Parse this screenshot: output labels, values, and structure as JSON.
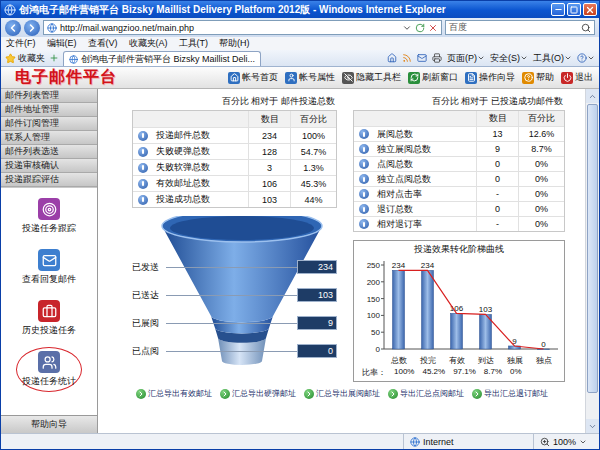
{
  "window": {
    "title": "创鸿电子邮件营销平台 Bizsky Maillist Delivery Platform 2012版 - Windows Internet Explorer"
  },
  "address_bar": {
    "url": "http://mail.wangzioo.net/main.php",
    "search": "百度"
  },
  "menu": [
    "文件(F)",
    "编辑(E)",
    "查看(V)",
    "收藏夹(A)",
    "工具(T)",
    "帮助(H)"
  ],
  "favorites": {
    "label": "收藏夹"
  },
  "tabs": [
    {
      "label": "创鸿电子邮件营销平台 Bizsky Maillist Deli...",
      "selected": true
    }
  ],
  "command_bar": [
    "页面(P)",
    "安全(S)",
    "工具(O)"
  ],
  "app_header": {
    "logo": "电子邮件平台",
    "nav": [
      "帐号首页",
      "帐号属性",
      "隐藏工具栏",
      "刷新窗口",
      "操作向导",
      "帮助",
      "退出"
    ]
  },
  "sidebar": {
    "menu": [
      {
        "label": "邮件列表管理",
        "selected": false
      },
      {
        "label": "邮件地址管理",
        "selected": false
      },
      {
        "label": "邮件订阅管理",
        "selected": false
      },
      {
        "label": "联系人管理",
        "selected": false
      },
      {
        "label": "邮件列表选送",
        "selected": false
      },
      {
        "label": "投递审核确认",
        "selected": false
      },
      {
        "label": "投递跟踪评估",
        "selected": false
      }
    ],
    "tools": [
      {
        "label": "投递任务跟踪",
        "selected": false
      },
      {
        "label": "查看回复邮件",
        "selected": false
      },
      {
        "label": "历史投递任务",
        "selected": false
      },
      {
        "label": "投递任务统计",
        "selected": true
      }
    ],
    "footer": "帮助向导"
  },
  "delivery_table": {
    "caption": "百分比 相对于 邮件投递总数",
    "columns": [
      "数目",
      "百分比"
    ],
    "rows": [
      {
        "label": "投递邮件总数",
        "count": "234",
        "percent": "100%"
      },
      {
        "label": "失败硬弹总数",
        "count": "128",
        "percent": "54.7%"
      },
      {
        "label": "失败软弹总数",
        "count": "3",
        "percent": "1.3%"
      },
      {
        "label": "有效邮址总数",
        "count": "106",
        "percent": "45.3%"
      },
      {
        "label": "投递成功总数",
        "count": "103",
        "percent": "44%"
      }
    ]
  },
  "open_table": {
    "caption": "百分比 相对于 已投递成功邮件数",
    "columns": [
      "数目",
      "百分比"
    ],
    "rows": [
      {
        "label": "展阅总数",
        "count": "13",
        "percent": "12.6%"
      },
      {
        "label": "独立展阅总数",
        "count": "9",
        "percent": "8.7%"
      },
      {
        "label": "点阅总数",
        "count": "0",
        "percent": "0%"
      },
      {
        "label": "独立点阅总数",
        "count": "0",
        "percent": "0%"
      },
      {
        "label": "相对点击率",
        "count": "-",
        "percent": "0%"
      },
      {
        "label": "退订总数",
        "count": "0",
        "percent": "0%"
      },
      {
        "label": "相对退订率",
        "count": "-",
        "percent": "0%"
      }
    ]
  },
  "funnel": {
    "stages": [
      {
        "label": "已发送",
        "value": "234"
      },
      {
        "label": "已送达",
        "value": "103"
      },
      {
        "label": "已展阅",
        "value": "9"
      },
      {
        "label": "已点阅",
        "value": "0"
      }
    ]
  },
  "chart": {
    "title": "投递效果转化阶梯曲线",
    "y_ticks": [
      "0",
      "50",
      "100",
      "150",
      "200",
      "250"
    ],
    "categories": [
      "总数",
      "投完",
      "有效",
      "到达",
      "独展",
      "独点"
    ],
    "values": [
      234,
      234,
      106,
      103,
      9,
      0
    ],
    "value_labels": [
      "234",
      "234",
      "106",
      "103",
      "9",
      "0"
    ],
    "line": [
      234,
      234,
      106,
      103,
      9,
      0
    ],
    "ratio_label": "比率：",
    "ratios": [
      "100%",
      "45.2%",
      "97.1%",
      "8.7%",
      "0%"
    ]
  },
  "export_links": [
    "汇总导出有效邮址",
    "汇总导出硬弹邮址",
    "汇总导出展阅邮址",
    "导出汇总点阅邮址",
    "导出汇总退订邮址"
  ],
  "scrollbar": {
    "level": 0.92
  },
  "status_bar": {
    "zone": "Internet",
    "zoom": "100%"
  }
}
